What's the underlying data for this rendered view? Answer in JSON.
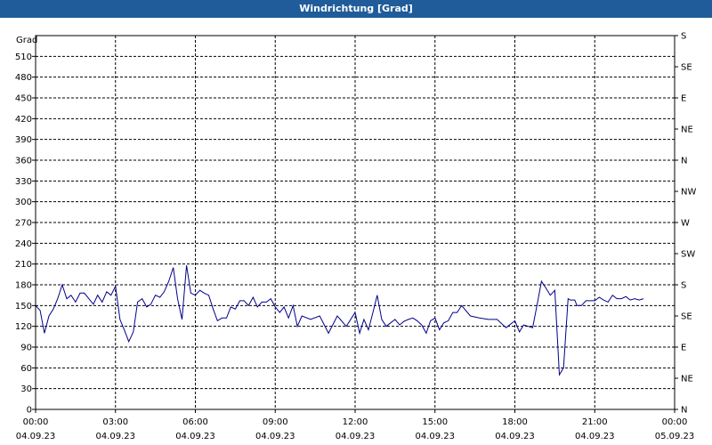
{
  "window": {
    "title": "Windrichtung [Grad]"
  },
  "chart_data": {
    "type": "line",
    "title": "Windrichtung [Grad]",
    "ylabel": "Grad",
    "ylim": [
      0,
      540
    ],
    "yticks": [
      0,
      30,
      60,
      90,
      120,
      150,
      180,
      210,
      240,
      270,
      300,
      330,
      360,
      390,
      420,
      450,
      480,
      510
    ],
    "xlim_hours": [
      0,
      24
    ],
    "xticks": [
      {
        "hours": 0,
        "time": "00:00",
        "date": "04.09.23"
      },
      {
        "hours": 3,
        "time": "03:00",
        "date": "04.09.23"
      },
      {
        "hours": 6,
        "time": "06:00",
        "date": "04.09.23"
      },
      {
        "hours": 9,
        "time": "09:00",
        "date": "04.09.23"
      },
      {
        "hours": 12,
        "time": "12:00",
        "date": "04.09.23"
      },
      {
        "hours": 15,
        "time": "15:00",
        "date": "04.09.23"
      },
      {
        "hours": 18,
        "time": "18:00",
        "date": "04.09.23"
      },
      {
        "hours": 21,
        "time": "21:00",
        "date": "04.09.23"
      },
      {
        "hours": 24,
        "time": "00:00",
        "date": "05.09.23"
      }
    ],
    "right_axis": {
      "labels": [
        {
          "value": 540,
          "label": "S"
        },
        {
          "value": 495,
          "label": "SE"
        },
        {
          "value": 450,
          "label": "E"
        },
        {
          "value": 405,
          "label": "NE"
        },
        {
          "value": 360,
          "label": "N"
        },
        {
          "value": 315,
          "label": "NW"
        },
        {
          "value": 270,
          "label": "W"
        },
        {
          "value": 225,
          "label": "SW"
        },
        {
          "value": 180,
          "label": "S"
        },
        {
          "value": 135,
          "label": "SE"
        },
        {
          "value": 90,
          "label": "E"
        },
        {
          "value": 45,
          "label": "NE"
        },
        {
          "value": 0,
          "label": "N"
        }
      ]
    },
    "grid": true,
    "series": [
      {
        "name": "",
        "color": "#00008b",
        "x_hours": [
          0,
          0.17,
          0.33,
          0.5,
          0.67,
          0.83,
          1.0,
          1.17,
          1.33,
          1.5,
          1.67,
          1.83,
          2.0,
          2.17,
          2.33,
          2.5,
          2.67,
          2.83,
          3.0,
          3.17,
          3.33,
          3.5,
          3.67,
          3.83,
          4.0,
          4.17,
          4.33,
          4.5,
          4.67,
          4.83,
          5.0,
          5.17,
          5.33,
          5.5,
          5.67,
          5.83,
          6.0,
          6.17,
          6.33,
          6.5,
          6.67,
          6.83,
          7.0,
          7.17,
          7.33,
          7.5,
          7.67,
          7.83,
          8.0,
          8.17,
          8.33,
          8.5,
          8.67,
          8.83,
          9.0,
          9.17,
          9.33,
          9.5,
          9.67,
          9.83,
          10.0,
          10.33,
          10.67,
          11.0,
          11.33,
          11.67,
          12.0,
          12.17,
          12.33,
          12.5,
          12.67,
          12.83,
          13.0,
          13.17,
          13.33,
          13.5,
          13.67,
          13.83,
          14.0,
          14.17,
          14.33,
          14.5,
          14.67,
          14.83,
          15.0,
          15.17,
          15.33,
          15.5,
          15.67,
          15.83,
          16.0,
          16.33,
          16.67,
          17.0,
          17.33,
          17.67,
          18.0,
          18.17,
          18.33,
          18.5,
          18.67,
          18.83,
          19.0,
          19.17,
          19.33,
          19.5,
          19.67,
          19.83,
          20.0,
          20.08,
          20.17,
          20.25,
          20.33,
          20.5,
          20.67,
          21.0,
          21.17,
          21.33,
          21.5,
          21.67,
          21.83,
          22.0,
          22.17,
          22.33,
          22.5,
          22.67,
          22.83,
          23.0,
          23.17,
          23.33,
          23.5,
          23.67,
          23.83
        ],
        "values": [
          150,
          143,
          110,
          135,
          145,
          160,
          180,
          160,
          165,
          155,
          168,
          168,
          160,
          152,
          165,
          155,
          170,
          165,
          178,
          130,
          115,
          98,
          112,
          155,
          160,
          148,
          152,
          165,
          162,
          170,
          185,
          205,
          160,
          130,
          208,
          168,
          165,
          172,
          168,
          165,
          145,
          128,
          132,
          132,
          148,
          145,
          157,
          157,
          150,
          162,
          148,
          155,
          155,
          160,
          148,
          140,
          148,
          132,
          150,
          120,
          135,
          130,
          135,
          110,
          135,
          120,
          140,
          110,
          130,
          115,
          140,
          165,
          130,
          120,
          125,
          130,
          122,
          127,
          130,
          132,
          128,
          122,
          110,
          128,
          132,
          115,
          125,
          128,
          140,
          140,
          150,
          135,
          132,
          130,
          130,
          118,
          128,
          112,
          122,
          120,
          118,
          150,
          185,
          175,
          165,
          172,
          50,
          60,
          160,
          158,
          158,
          158,
          150,
          150,
          157,
          157,
          162,
          158,
          155,
          165,
          160,
          160,
          163,
          158,
          160,
          158,
          160
        ]
      }
    ]
  }
}
